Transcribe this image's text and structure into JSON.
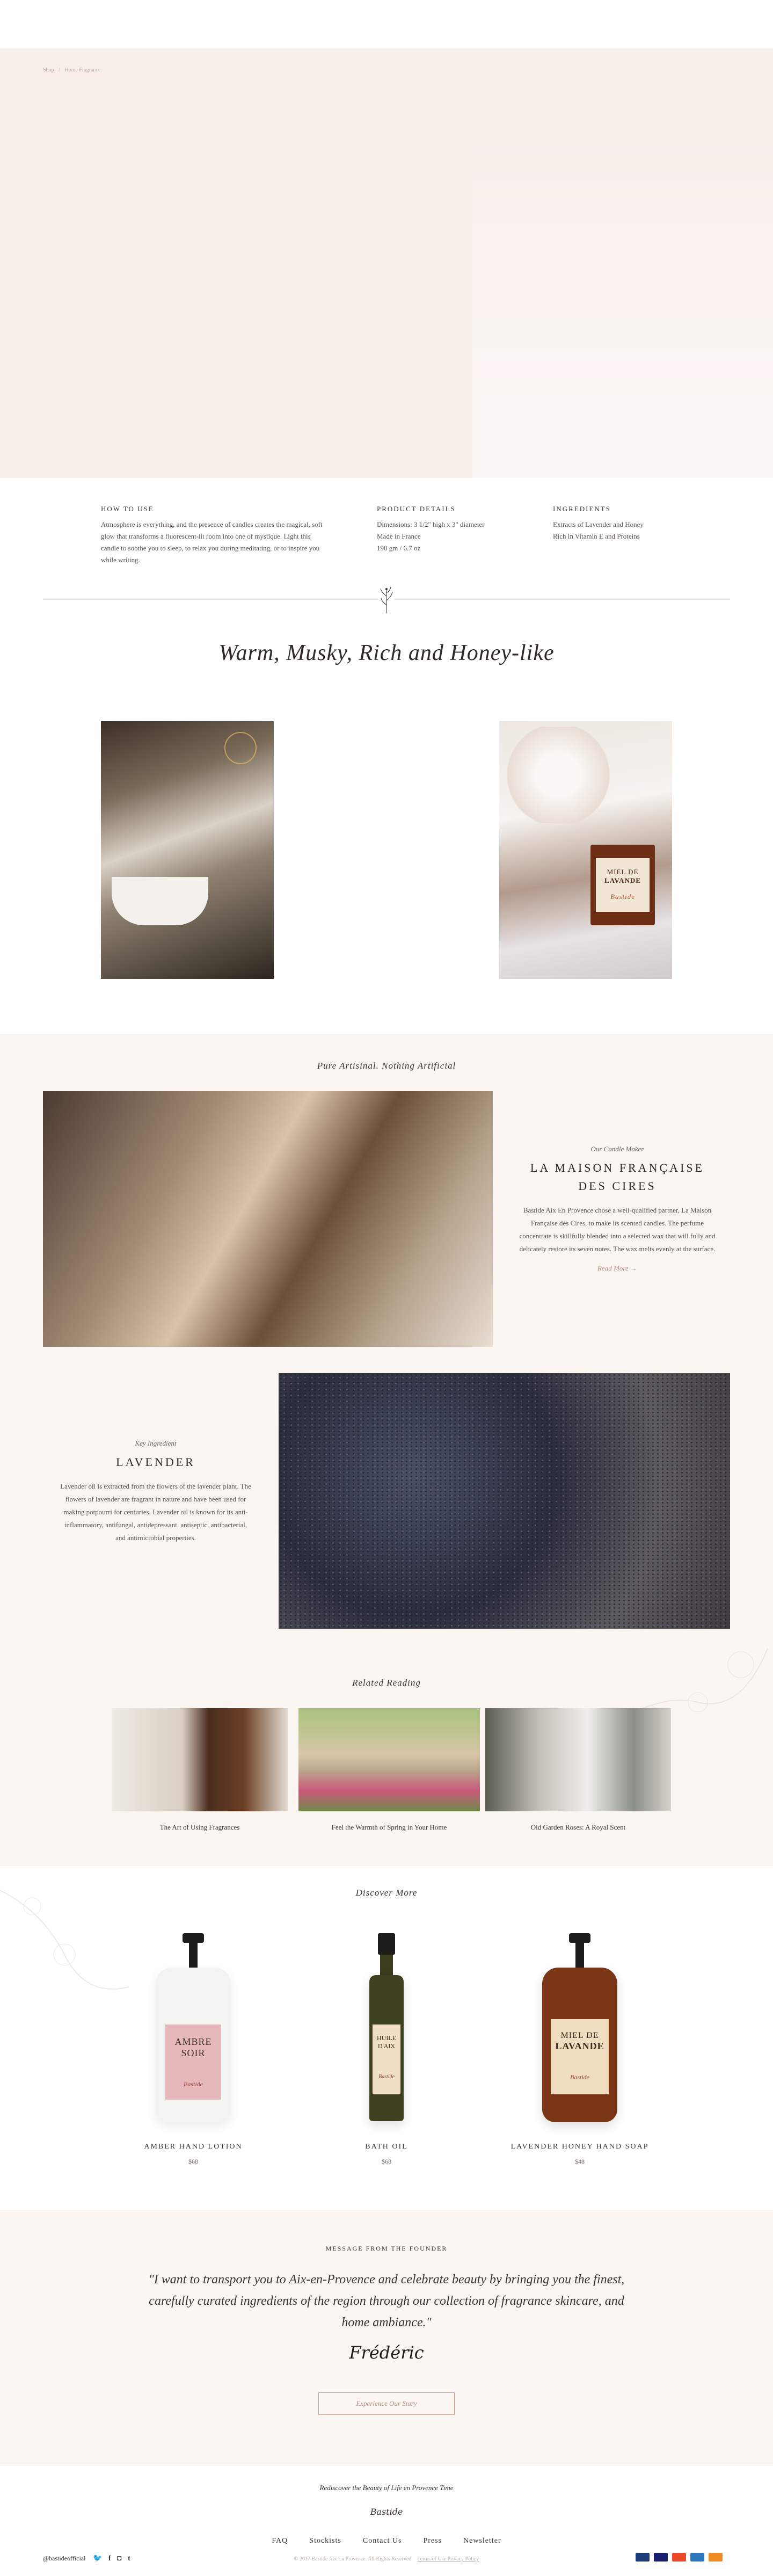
{
  "breadcrumb": {
    "home": "Shop",
    "sep": "/",
    "current": "Home Fragrance"
  },
  "product_info": {
    "how_to_use": {
      "title": "HOW TO USE",
      "body": "Atmosphere is everything, and the presence of candles creates the magical, soft glow that transforms a fluorescent-lit room into one of mystique. Light this candle to soothe you to sleep, to relax you during meditating, or to inspire you while writing."
    },
    "details": {
      "title": "PRODUCT DETAILS",
      "lines": [
        "Dimensions: 3 1/2\" high x 3\" diameter",
        "Made in France",
        "190 gm / 6.7 oz"
      ]
    },
    "ingredients": {
      "title": "INGREDIENTS",
      "lines": [
        "Extracts of Lavender and Honey",
        "Rich in Vitamin E and Proteins"
      ]
    }
  },
  "feature_title": "Warm, Musky, Rich and Honey-like",
  "candle_label": {
    "line1": "MIEL DE",
    "line2": "LAVANDE",
    "brand": "Bastide"
  },
  "artisanal": {
    "heading": "Pure Artisinal. Nothing Artificial",
    "maker": {
      "kicker": "Our Candle Maker",
      "title": "LA MAISON FRANÇAISE DES CIRES",
      "body": "Bastide Aix En Provence chose a well-qualified partner, La Maison Française des Cires, to make its scented candles. The perfume concentrate is skillfully blended into a selected wax that will fully and delicately restore its seven notes. The wax melts evenly at the surface.",
      "link": "Read More →"
    },
    "ingredient": {
      "kicker": "Key Ingredient",
      "title": "LAVENDER",
      "body": "Lavender oil is extracted from the flowers of the lavender plant. The flowers of lavender are fragrant in nature and have been used for making potpourri for centuries. Lavender oil is known for its anti-inflammatory, antifungal, antidepressant, antiseptic, antibacterial, and antimicrobial properties."
    }
  },
  "related": {
    "heading": "Related Reading",
    "items": [
      {
        "caption": "The Art of Using Fragrances"
      },
      {
        "caption": "Feel the Warmth of Spring in Your Home"
      },
      {
        "caption": "Old Garden Roses: A Royal Scent"
      }
    ]
  },
  "discover": {
    "heading": "Discover More",
    "products": [
      {
        "name": "AMBER HAND LOTION",
        "price": "$68",
        "label1": "AMBRE",
        "label2": "SOIR",
        "brand": "Bastide"
      },
      {
        "name": "BATH OIL",
        "price": "$68",
        "label1": "HUILE",
        "label2": "D'AIX",
        "brand": "Bastide"
      },
      {
        "name": "LAVENDER HONEY HAND SOAP",
        "price": "$48",
        "label1": "MIEL DE",
        "label2": "LAVANDE",
        "brand": "Bastide"
      }
    ]
  },
  "founder": {
    "heading": "MESSAGE FROM THE FOUNDER",
    "quote": "\"I want to transport you to Aix-en-Provence and celebrate beauty by bringing you the finest, carefully curated ingredients of the region through our collection of fragrance skincare, and home ambiance.\"",
    "signature": "Frédéric",
    "button": "Experience Our Story"
  },
  "footer": {
    "tagline": "Rediscover the Beauty of Life en Provence Time",
    "brand": "Bastide",
    "nav": [
      "FAQ",
      "Stockists",
      "Contact Us",
      "Press",
      "Newsletter"
    ],
    "copyright": "© 2017 Bastide Aix En Provence. All Rights Reserved.",
    "legal": "Terms of Use  Privacy Policy",
    "handle": "@bastideofficial",
    "social_icons": [
      "twitter-icon",
      "facebook-icon",
      "instagram-icon",
      "tumblr-icon"
    ],
    "payments": [
      "paypal",
      "visa",
      "mastercard",
      "amex",
      "discover"
    ]
  },
  "colors": {
    "hero_bg": "#f8eeea",
    "section_bg": "#fcf6f3",
    "accent": "#b38f80",
    "text": "#3a3330"
  }
}
